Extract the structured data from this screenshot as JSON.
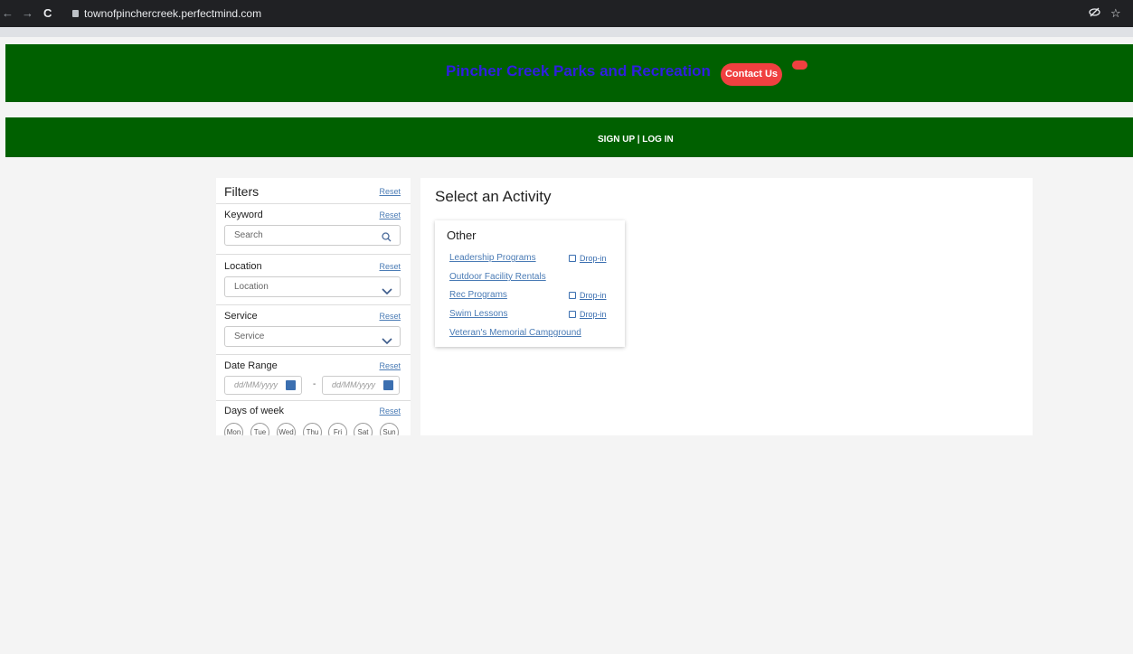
{
  "browser": {
    "url": "townofpinchercreek.perfectmind.com",
    "back_icon": "arrow-left-icon",
    "forward_icon": "arrow-right-icon",
    "reload_icon": "reload-icon"
  },
  "header": {
    "title": "Pincher Creek Parks and Recreation",
    "contact_label": "Contact Us",
    "auth_label": "SIGN UP | LOG IN"
  },
  "filters": {
    "title": "Filters",
    "reset_label": "Reset",
    "keyword": {
      "label": "Keyword",
      "placeholder": "Search"
    },
    "location": {
      "label": "Location",
      "value": "Location"
    },
    "service": {
      "label": "Service",
      "value": "Service"
    },
    "date_range": {
      "label": "Date Range",
      "from_placeholder": "dd/MM/yyyy",
      "to_placeholder": "dd/MM/yyyy",
      "separator": "-"
    },
    "days_of_week": {
      "label": "Days of week",
      "days": [
        "Mon",
        "Tue",
        "Wed",
        "Thu",
        "Fri",
        "Sat",
        "Sun"
      ]
    }
  },
  "main": {
    "title": "Select an Activity",
    "category": "Other",
    "activities": [
      {
        "name": "Leadership Programs",
        "tag": "Drop-in"
      },
      {
        "name": "Outdoor Facility Rentals",
        "tag": ""
      },
      {
        "name": "Rec Programs",
        "tag": "Drop-in"
      },
      {
        "name": "Swim Lessons",
        "tag": "Drop-in"
      },
      {
        "name": "Veteran's Memorial Campground",
        "tag": ""
      }
    ]
  },
  "colors": {
    "banner_green": "#006000",
    "contact_red": "#f04040",
    "title_blue": "#2f1ee0",
    "link_blue": "#4a7bb5"
  }
}
